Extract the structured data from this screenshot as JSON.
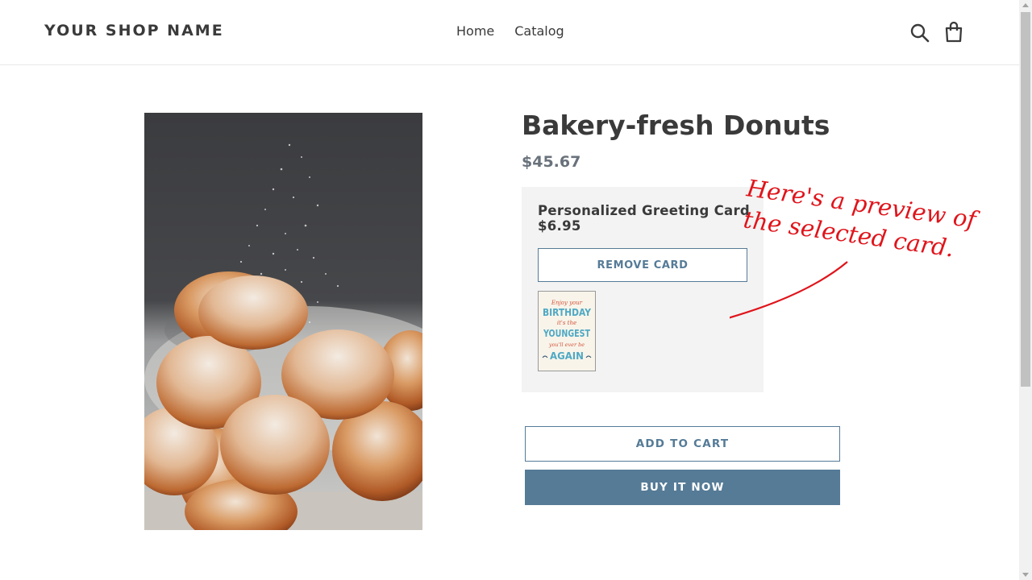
{
  "header": {
    "shop_name": "YOUR SHOP NAME",
    "nav": [
      {
        "label": "Home"
      },
      {
        "label": "Catalog"
      }
    ],
    "icons": [
      "search-icon",
      "cart-icon"
    ]
  },
  "product": {
    "title": "Bakery-fresh Donuts",
    "price": "$45.67",
    "image": "donuts-photo"
  },
  "greeting_card": {
    "title": "Personalized Greeting Card",
    "price": "$6.95",
    "remove_label": "REMOVE CARD",
    "preview_text": [
      "Enjoy your",
      "BIRTHDAY",
      "it's the",
      "YOUNGEST",
      "you'll ever be",
      "AGAIN"
    ]
  },
  "annotation": {
    "line1": "Here's a preview of",
    "line2": "the selected card."
  },
  "buttons": {
    "add_to_cart": "ADD TO CART",
    "buy_it_now": "BUY IT NOW"
  },
  "colors": {
    "accent": "#557b97",
    "annotation": "#e0141b",
    "text": "#3a3a3a",
    "price": "#69727b",
    "card_panel": "#f3f3f3"
  }
}
